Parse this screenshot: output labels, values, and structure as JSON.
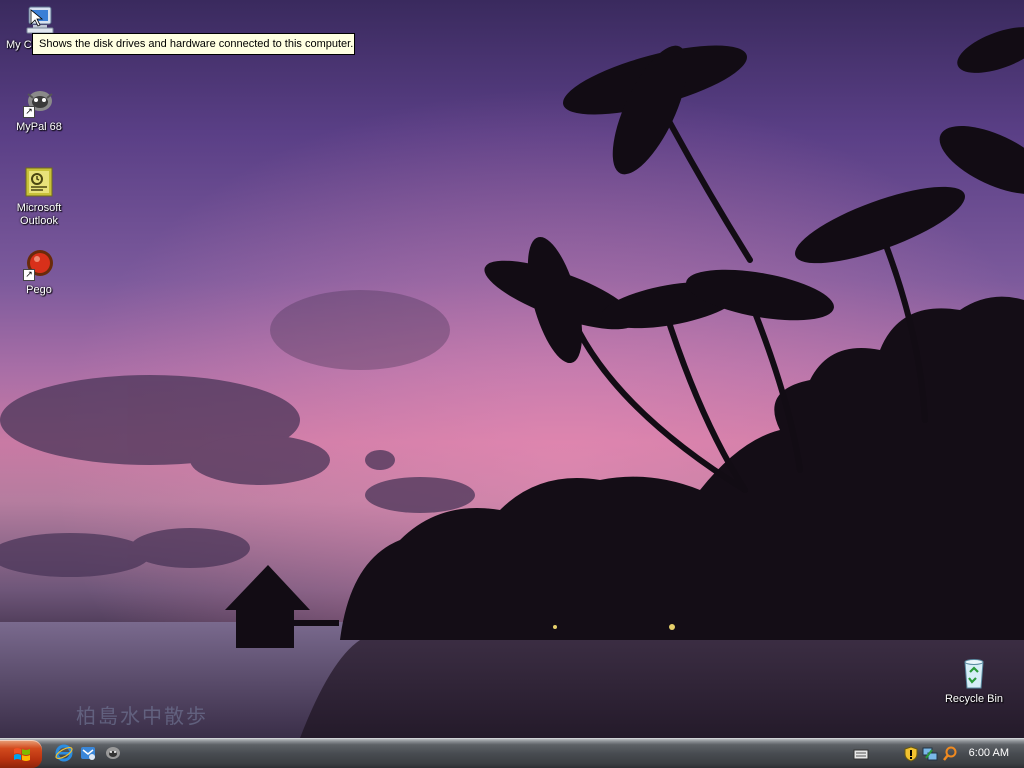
{
  "desktop": {
    "icons": [
      {
        "label": "My Co"
      },
      {
        "label": "MyPal 68"
      },
      {
        "label": "Microsoft Outlook"
      },
      {
        "label": "Pego"
      }
    ],
    "recycle_bin": {
      "label": "Recycle Bin"
    },
    "watermark": "柏島水中散歩"
  },
  "tooltip": {
    "text": "Shows the disk drives and hardware connected to this computer."
  },
  "taskbar": {
    "start_icon": "windows-flag-icon",
    "quick_launch": [
      "internet-explorer-icon",
      "outlook-express-icon",
      "mypal-icon"
    ],
    "tray_icons": [
      "keyboard-icon",
      "security-shield-icon",
      "network-icon",
      "search-icon"
    ],
    "clock": "6:00 AM"
  },
  "colors": {
    "tooltip_bg": "#ffffe1",
    "start_button": "#d24a1d",
    "taskbar": "#484c51"
  }
}
